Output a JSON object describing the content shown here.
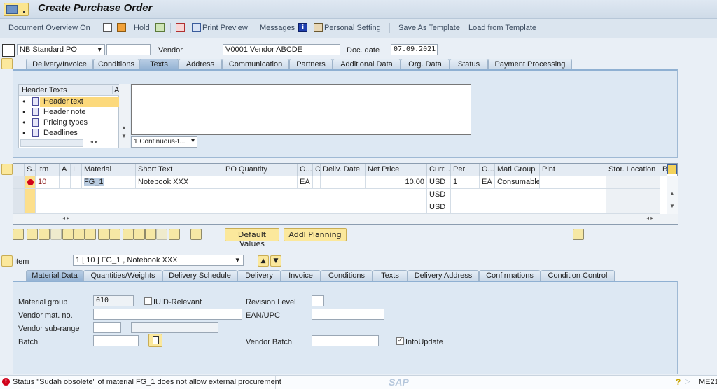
{
  "window": {
    "title": "Create Purchase Order"
  },
  "toolbar": {
    "document_overview": "Document Overview On",
    "hold": "Hold",
    "print_preview": "Print Preview",
    "messages": "Messages",
    "personal_setting": "Personal Setting",
    "save_as_template": "Save As Template",
    "load_from_template": "Load from Template"
  },
  "header": {
    "po_type": "NB Standard PO",
    "po_number": "",
    "vendor_label": "Vendor",
    "vendor_value": "V0001 Vendor ABCDE",
    "doc_date_label": "Doc. date",
    "doc_date_value": "07.09.2021",
    "tabs": [
      "Delivery/Invoice",
      "Conditions",
      "Texts",
      "Address",
      "Communication",
      "Partners",
      "Additional Data",
      "Org. Data",
      "Status",
      "Payment Processing"
    ],
    "active_tab": "Texts",
    "texts": {
      "tree_header": "Header Texts",
      "tree_col2": "A",
      "items": [
        "Header text",
        "Header note",
        "Pricing types",
        "Deadlines"
      ],
      "selected": "Header text",
      "editor_value": "",
      "format_select": "1 Continuous-t..."
    }
  },
  "items_grid": {
    "columns": [
      "S..",
      "Itm",
      "A",
      "I",
      "Material",
      "Short Text",
      "PO Quantity",
      "O...",
      "C",
      "Deliv. Date",
      "Net Price",
      "Curr...",
      "Per",
      "O...",
      "Matl Group",
      "Plnt",
      "Stor. Location",
      "B"
    ],
    "rows": [
      {
        "status": "error",
        "itm": "10",
        "a": "",
        "i": "",
        "material": "FG_1",
        "short_text": "Notebook XXX",
        "po_qty": "",
        "oun": "EA",
        "c": "",
        "deliv_date": "",
        "net_price": "10,00",
        "curr": "USD",
        "per": "1",
        "opu": "EA",
        "matl_group": "Consumables",
        "plnt": "",
        "sloc": ""
      },
      {
        "status": "",
        "itm": "",
        "a": "",
        "i": "",
        "material": "",
        "short_text": "",
        "po_qty": "",
        "oun": "",
        "c": "",
        "deliv_date": "",
        "net_price": "",
        "curr": "USD",
        "per": "",
        "opu": "",
        "matl_group": "",
        "plnt": "",
        "sloc": ""
      },
      {
        "status": "",
        "itm": "",
        "a": "",
        "i": "",
        "material": "",
        "short_text": "",
        "po_qty": "",
        "oun": "",
        "c": "",
        "deliv_date": "",
        "net_price": "",
        "curr": "USD",
        "per": "",
        "opu": "",
        "matl_group": "",
        "plnt": "",
        "sloc": ""
      }
    ],
    "buttons": {
      "default_values": "Default Values",
      "addl_planning": "Addl Planning"
    }
  },
  "item_detail": {
    "item_label": "Item",
    "item_select": "1 [ 10 ] FG_1 , Notebook XXX",
    "tabs": [
      "Material Data",
      "Quantities/Weights",
      "Delivery Schedule",
      "Delivery",
      "Invoice",
      "Conditions",
      "Texts",
      "Delivery Address",
      "Confirmations",
      "Condition Control"
    ],
    "active_tab": "Material Data",
    "fields": {
      "material_group_label": "Material group",
      "material_group_value": "010",
      "iuid_label": "IUID-Relevant",
      "iuid_checked": false,
      "revision_level_label": "Revision Level",
      "revision_level_value": "",
      "vendor_mat_no_label": "Vendor mat. no.",
      "vendor_mat_no_value": "",
      "ean_upc_label": "EAN/UPC",
      "ean_upc_value": "",
      "vendor_subrange_label": "Vendor sub-range",
      "vendor_subrange_value": "",
      "vendor_subrange_desc": "",
      "batch_label": "Batch",
      "batch_value": "",
      "vendor_batch_label": "Vendor Batch",
      "vendor_batch_value": "",
      "infoupdate_label": "InfoUpdate",
      "infoupdate_checked": true
    }
  },
  "statusbar": {
    "message": "Status \"Sudah obsolete\" of material FG_1 does not allow external procurement",
    "message_type": "error",
    "logo": "SAP",
    "transaction": "ME21"
  },
  "colors": {
    "accent_yellow": "#fbe58f",
    "error_red": "#d0021b",
    "selected_row": "#fcd97c"
  }
}
